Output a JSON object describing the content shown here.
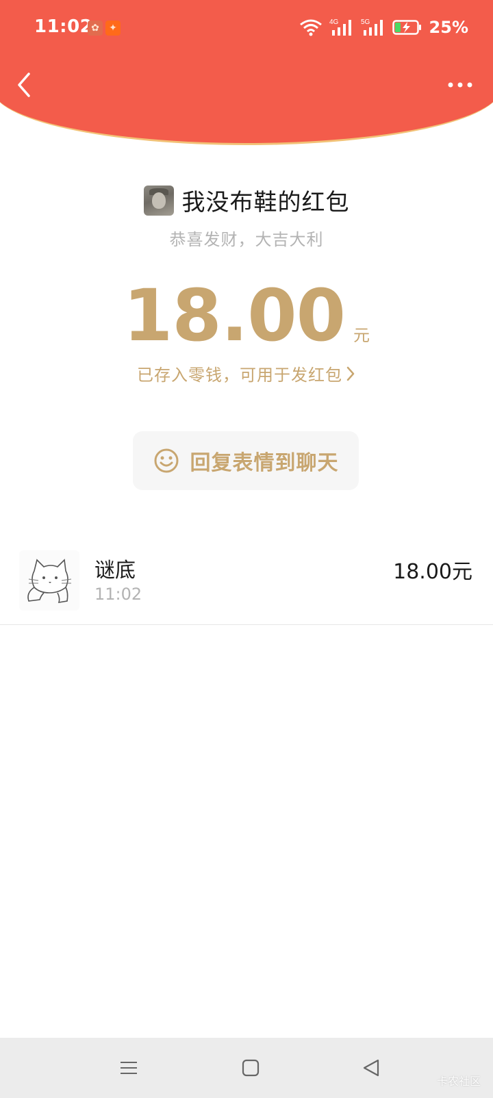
{
  "status_bar": {
    "time": "11:02",
    "network_4g": "4G",
    "network_5g": "5G",
    "battery_percent": "25%",
    "icons": [
      "wechat-icon",
      "kuaishou-icon",
      "wifi-icon",
      "signal-4g-icon",
      "signal-5g-icon",
      "battery-charging-icon"
    ]
  },
  "header": {
    "back_icon": "chevron-left-icon",
    "more_icon": "more-dots-icon",
    "background_color": "#f35c4b",
    "border_color": "#f2c277"
  },
  "packet": {
    "sender_title": "我没布鞋的红包",
    "greeting": "恭喜发财，大吉大利",
    "amount": "18.00",
    "unit": "元",
    "saved_text": "已存入零钱，可用于发红包",
    "accent_color": "#c8a670"
  },
  "reply_button": {
    "label": "回复表情到聊天",
    "icon": "smiley-icon"
  },
  "records": [
    {
      "name": "谜底",
      "time": "11:02",
      "amount": "18.00元",
      "avatar_icon": "cat-avatar-icon"
    }
  ],
  "bottom_nav": {
    "menu_icon": "menu-icon",
    "home_icon": "home-square-icon",
    "back_icon": "back-triangle-icon"
  },
  "watermark": "卡农社区"
}
